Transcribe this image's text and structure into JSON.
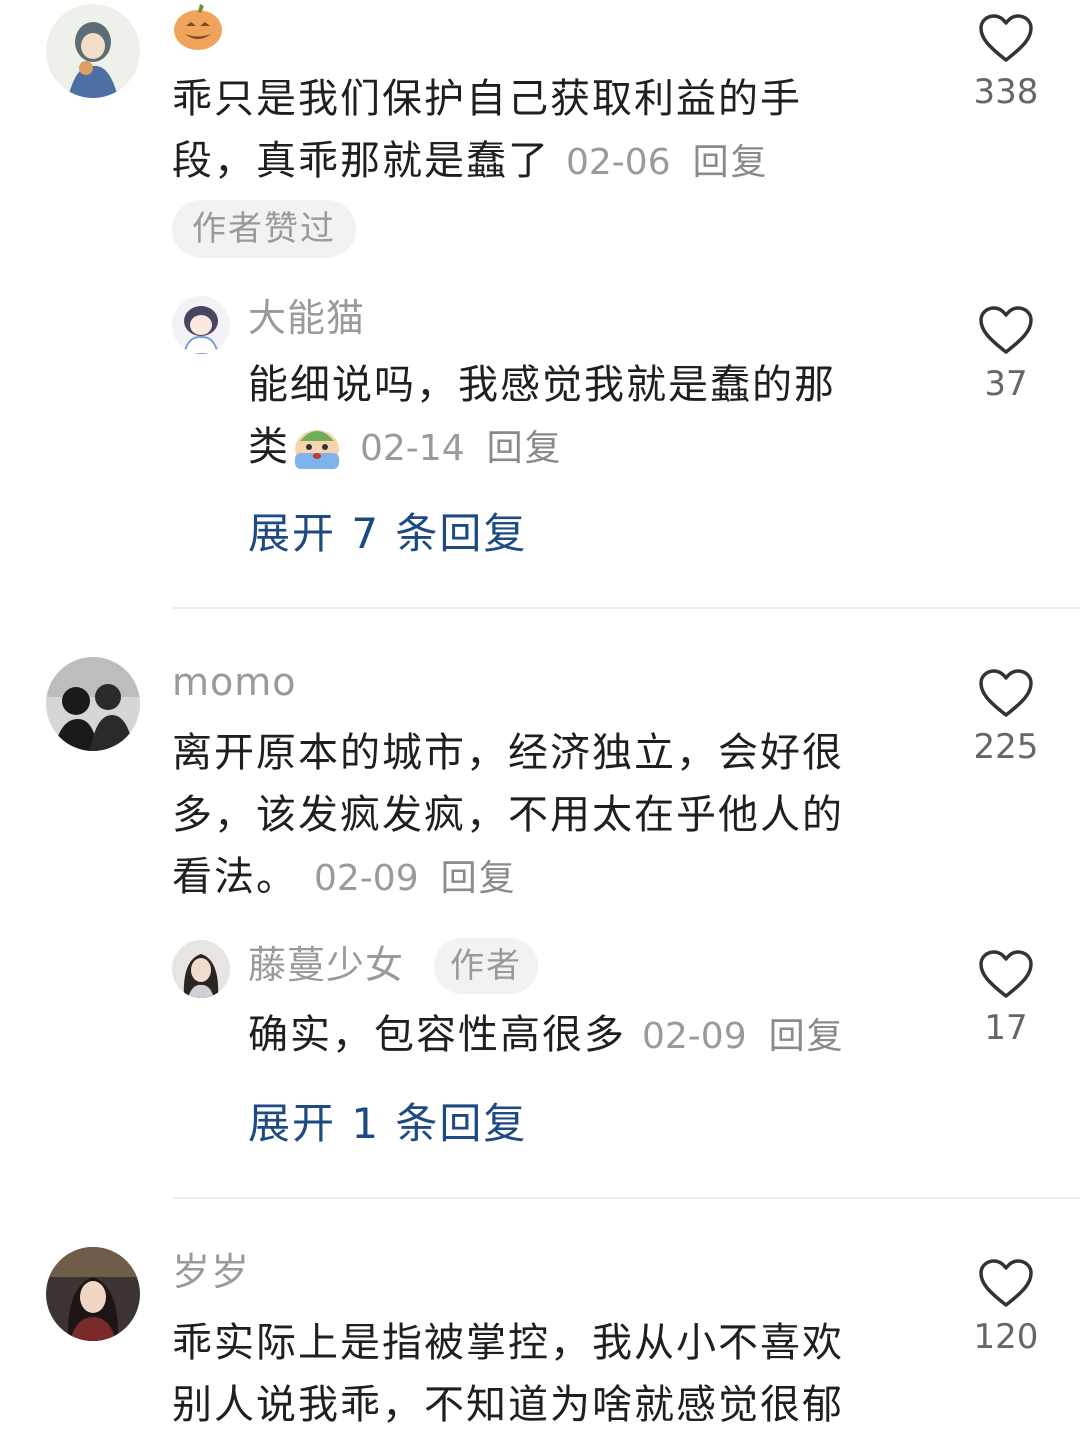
{
  "comment1": {
    "emoji": "pumpkin-emoji",
    "line1": "乖只是我们保护自己获取利益的手",
    "line2": "段，真乖那就是蠢了",
    "date": "02-06",
    "reply": "回复",
    "badge": "作者赞过",
    "likes": "338"
  },
  "reply1": {
    "username": "大能猫",
    "line1": "能细说吗，我感觉我就是蠢的那",
    "line2": "类",
    "emoji": "crying-emoji",
    "date": "02-14",
    "reply": "回复",
    "likes": "37",
    "expand": "展开 7 条回复"
  },
  "comment2": {
    "username": "momo",
    "line1": "离开原本的城市，经济独立，会好很",
    "line2": "多，该发疯发疯，不用太在乎他人的",
    "line3": "看法。",
    "date": "02-09",
    "reply": "回复",
    "likes": "225"
  },
  "reply2": {
    "username": "藤蔓少女",
    "author_tag": "作者",
    "line1": "确实，包容性高很多",
    "date": "02-09",
    "reply": "回复",
    "likes": "17",
    "expand": "展开 1 条回复"
  },
  "comment3": {
    "username": "岁岁",
    "line1": "乖实际上是指被掌控，我从小不喜欢",
    "line2": "别人说我乖，不知道为啥就感觉很郁",
    "likes": "120"
  },
  "colors": {
    "expand": "#1e4a82",
    "meta": "#9a9a9a",
    "pill_bg": "#f2f2f2"
  }
}
